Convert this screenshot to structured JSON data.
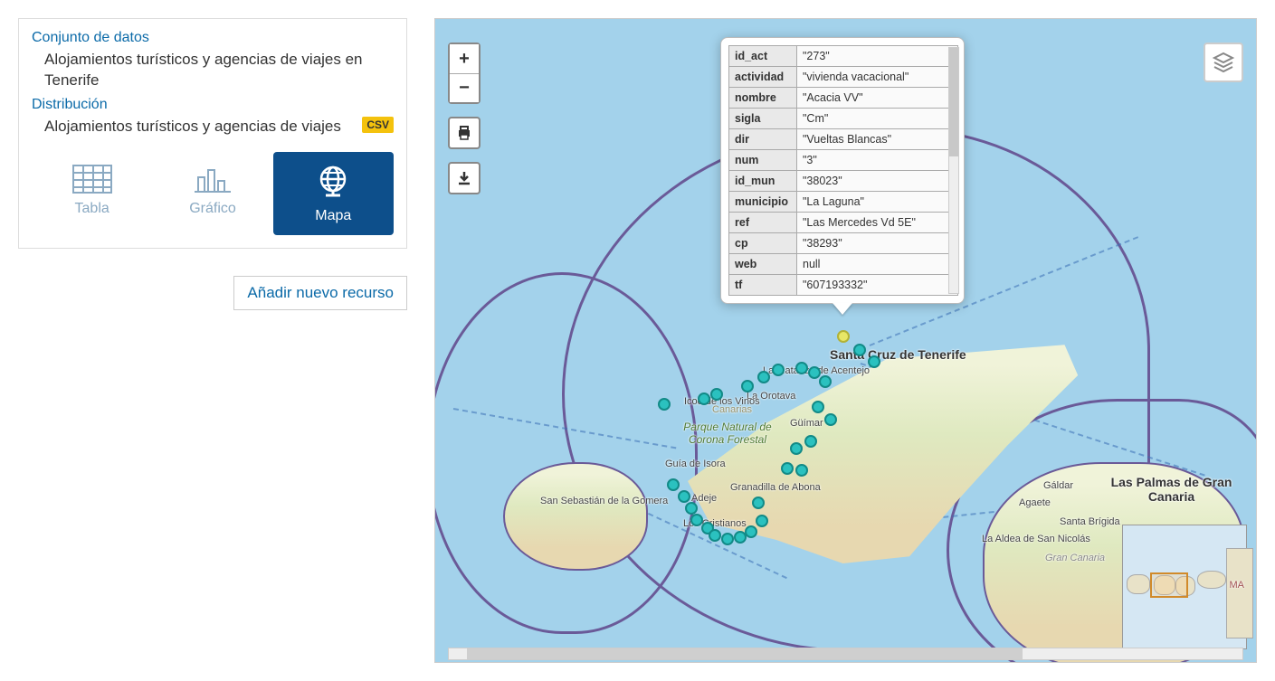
{
  "sidebar": {
    "dataset_label": "Conjunto de datos",
    "dataset_title": "Alojamientos turísticos y agencias de viajes en Tenerife",
    "distribution_label": "Distribución",
    "distribution_title": "Alojamientos turísticos y agencias de viajes",
    "format_badge": "CSV",
    "tabs": {
      "table": "Tabla",
      "chart": "Gráfico",
      "map": "Mapa"
    },
    "add_resource": "Añadir nuevo recurso"
  },
  "popup": {
    "rows": [
      {
        "key": "id_act",
        "val": "\"273\""
      },
      {
        "key": "actividad",
        "val": "\"vivienda vacacional\""
      },
      {
        "key": "nombre",
        "val": "\"Acacia VV\""
      },
      {
        "key": "sigla",
        "val": "\"Cm\""
      },
      {
        "key": "dir",
        "val": "\"Vueltas Blancas\""
      },
      {
        "key": "num",
        "val": "\"3\""
      },
      {
        "key": "id_mun",
        "val": "\"38023\""
      },
      {
        "key": "municipio",
        "val": "\"La Laguna\""
      },
      {
        "key": "ref",
        "val": "\"Las Mercedes Vd 5E\""
      },
      {
        "key": "cp",
        "val": "\"38293\""
      },
      {
        "key": "web",
        "val": "null"
      },
      {
        "key": "tf",
        "val": "\"607193332\""
      }
    ]
  },
  "map_labels": {
    "tenerife_city": "Santa Cruz de Tenerife",
    "matanza": "La Matanza de Acentejo",
    "orotava": "La Orotava",
    "icod": "Icod de los Vinos",
    "park": "Parque Natural de Corona Forestal",
    "canarias": "Canarias",
    "guimar": "Güímar",
    "isora": "Guía de Isora",
    "granadilla": "Granadilla de Abona",
    "adeje": "Adeje",
    "cristianos": "Los Cristianos",
    "gomera": "San Sebastián de la Gomera",
    "laspalmas": "Las Palmas de Gran Canaria",
    "galdar": "Gáldar",
    "agaete": "Agaete",
    "santabrigida": "Santa Brígida",
    "aldea": "La Aldea de San Nicolás",
    "grancanaria": "Gran Canaria",
    "minimap_tag": "MA"
  }
}
